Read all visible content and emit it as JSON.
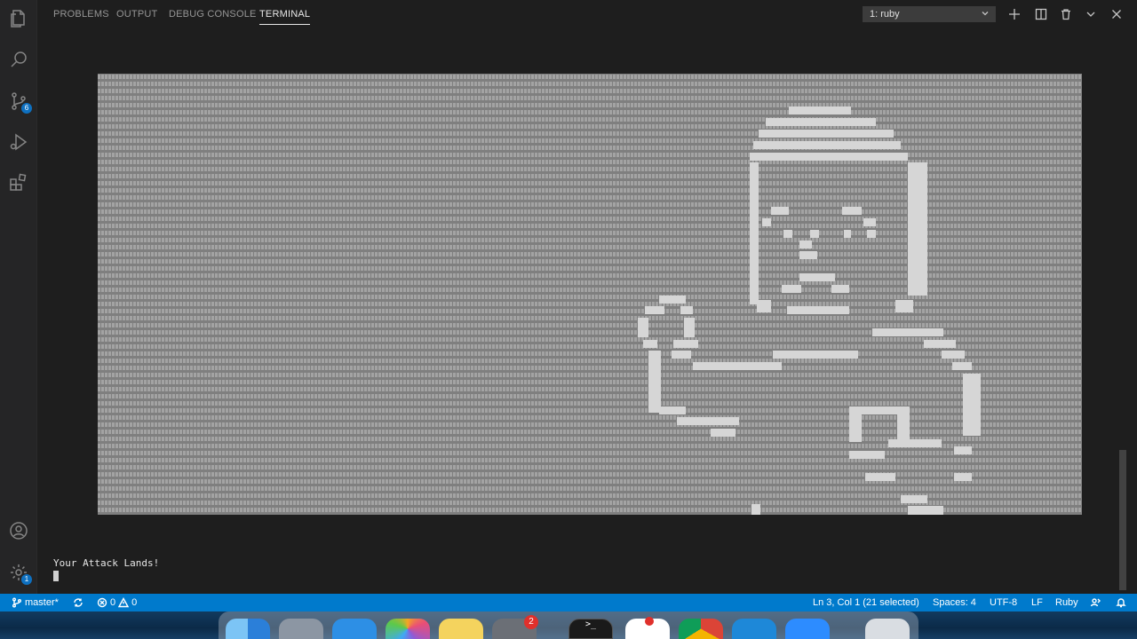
{
  "panel": {
    "tabs": [
      {
        "label": "PROBLEMS"
      },
      {
        "label": "OUTPUT"
      },
      {
        "label": "DEBUG CONSOLE"
      },
      {
        "label": "TERMINAL"
      }
    ],
    "terminal_select_value": "1: ruby"
  },
  "activity_bar": {
    "source_control_badge": "6",
    "settings_badge": "1"
  },
  "terminal": {
    "output_line": "Your Attack Lands!"
  },
  "status_bar": {
    "branch": "master*",
    "errors": "0",
    "warnings": "0",
    "cursor_position": "Ln 3, Col 1 (21 selected)",
    "indent": "Spaces: 4",
    "encoding": "UTF-8",
    "eol": "LF",
    "language": "Ruby"
  },
  "dock": {
    "mail_badge": "2",
    "terminal_glyph": ">_"
  },
  "colors": {
    "status_bar_bg": "#007acc",
    "terminal_bg": "#1e1e1e",
    "ascii_bg": "#8a8a8a",
    "ascii_fg": "#d4d4d4"
  }
}
